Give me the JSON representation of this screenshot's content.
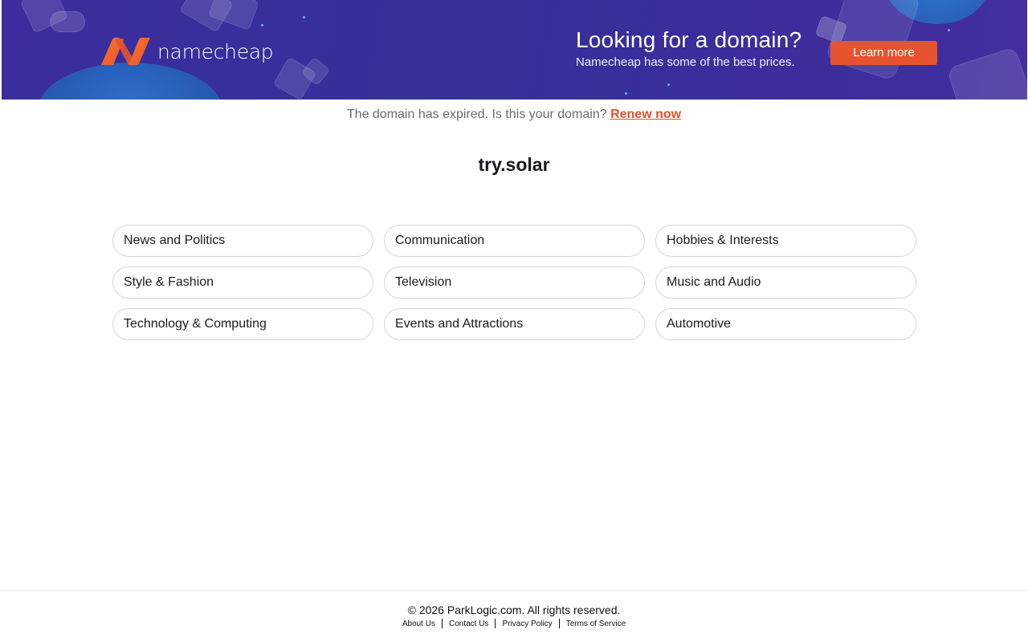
{
  "banner": {
    "brand_name": "namecheap",
    "logo_icon": "namecheap-logo-icon",
    "promo_title": "Looking for a domain?",
    "promo_subtitle": "Namecheap has some of the best prices.",
    "learn_more_label": "Learn more",
    "colors": {
      "background": "#3b2d9e",
      "accent": "#e8532f",
      "logo_gradient_start": "#f26a2d",
      "logo_gradient_end": "#f0522f"
    }
  },
  "notice": {
    "text": "The domain has expired. Is this your domain?",
    "renew_label": "Renew now"
  },
  "domain": "try.solar",
  "categories": [
    "News and Politics",
    "Communication",
    "Hobbies & Interests",
    "Style & Fashion",
    "Television",
    "Music and Audio",
    "Technology & Computing",
    "Events and Attractions",
    "Automotive"
  ],
  "footer": {
    "copyright": "© 2026 ParkLogic.com. All rights reserved.",
    "links": [
      "About Us",
      "Contact Us",
      "Privacy Policy",
      "Terms of Service"
    ]
  }
}
